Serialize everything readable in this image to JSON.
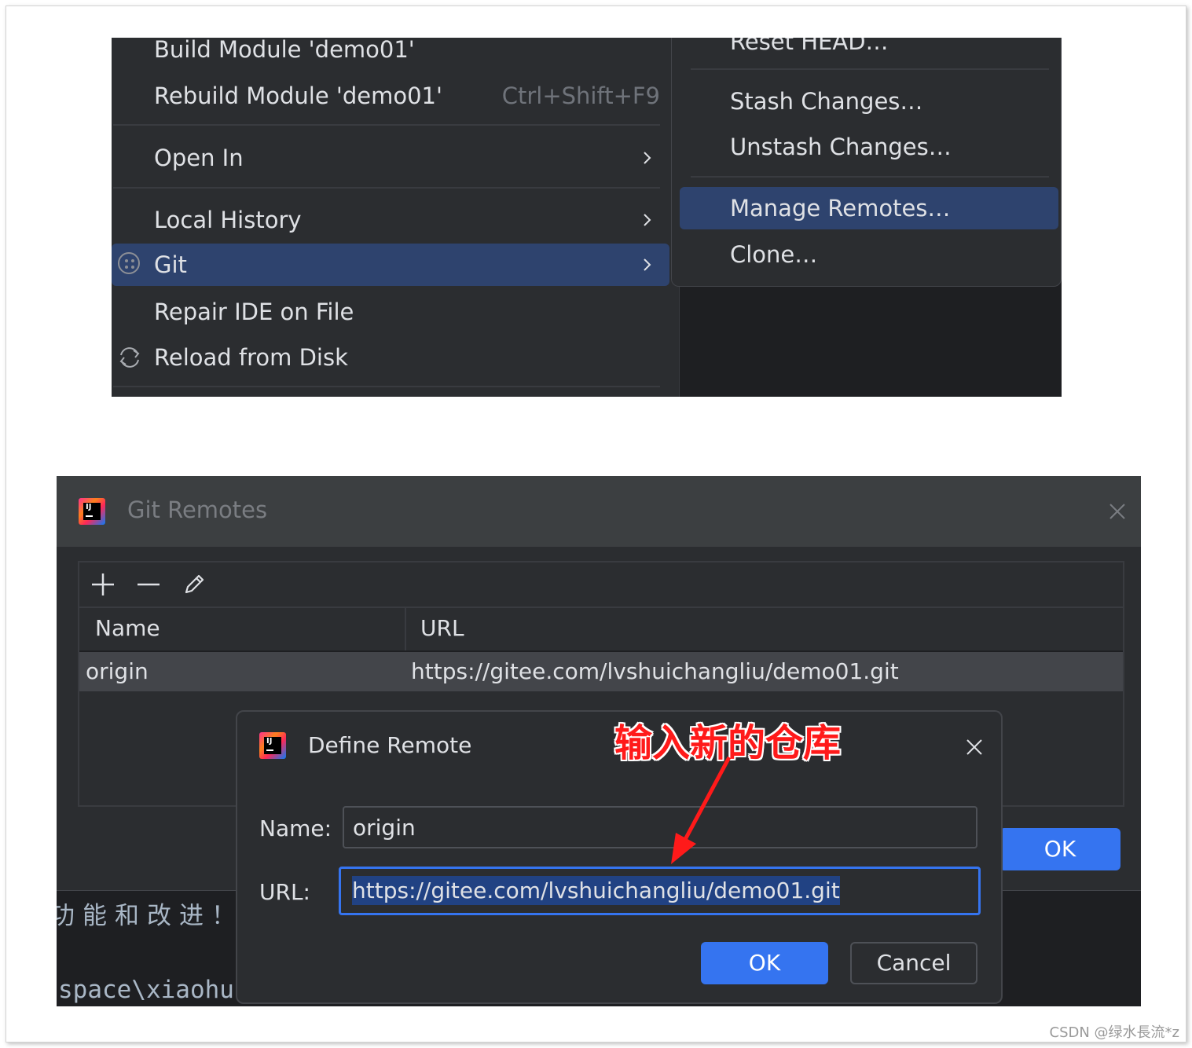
{
  "context_menu": {
    "left_items": [
      {
        "label": "Build Module 'demo01'",
        "shortcut": ""
      },
      {
        "label": "Rebuild Module 'demo01'",
        "shortcut": "Ctrl+Shift+F9"
      },
      {
        "label": "Open In",
        "submenu": true
      },
      {
        "label": "Local History",
        "submenu": true
      },
      {
        "label": "Git",
        "submenu": true,
        "selected": true
      },
      {
        "label": "Repair IDE on File"
      },
      {
        "label": "Reload from Disk"
      }
    ],
    "git_submenu": [
      {
        "label": "Reset HEAD…"
      },
      {
        "label": "Stash Changes…"
      },
      {
        "label": "Unstash Changes…"
      },
      {
        "label": "Manage Remotes…",
        "selected": true
      },
      {
        "label": "Clone…"
      }
    ]
  },
  "git_remotes": {
    "title": "Git Remotes",
    "table": {
      "columns": [
        "Name",
        "URL"
      ],
      "rows": [
        {
          "name": "origin",
          "url": "https://gitee.com/lvshuichangliu/demo01.git"
        }
      ]
    },
    "ok_label": "OK"
  },
  "terminal": {
    "line1": "功能和改进！",
    "line2": "space\\xiaohu"
  },
  "define_remote": {
    "title": "Define Remote",
    "name_label": "Name:",
    "name_value": "origin",
    "url_label": "URL:",
    "url_value": "https://gitee.com/lvshuichangliu/demo01.git",
    "ok_label": "OK",
    "cancel_label": "Cancel"
  },
  "annotation": "输入新的仓库",
  "watermark": "CSDN @绿水長流*z",
  "colors": {
    "menu_bg": "#2b2d30",
    "selection": "#2e436e",
    "primary_button": "#3574f0",
    "annotation_red": "#ff1a1a"
  },
  "icons": [
    "git-icon",
    "reload-icon",
    "chevron-right-icon",
    "intellij-logo",
    "close-icon",
    "add-icon",
    "remove-icon",
    "edit-icon"
  ]
}
